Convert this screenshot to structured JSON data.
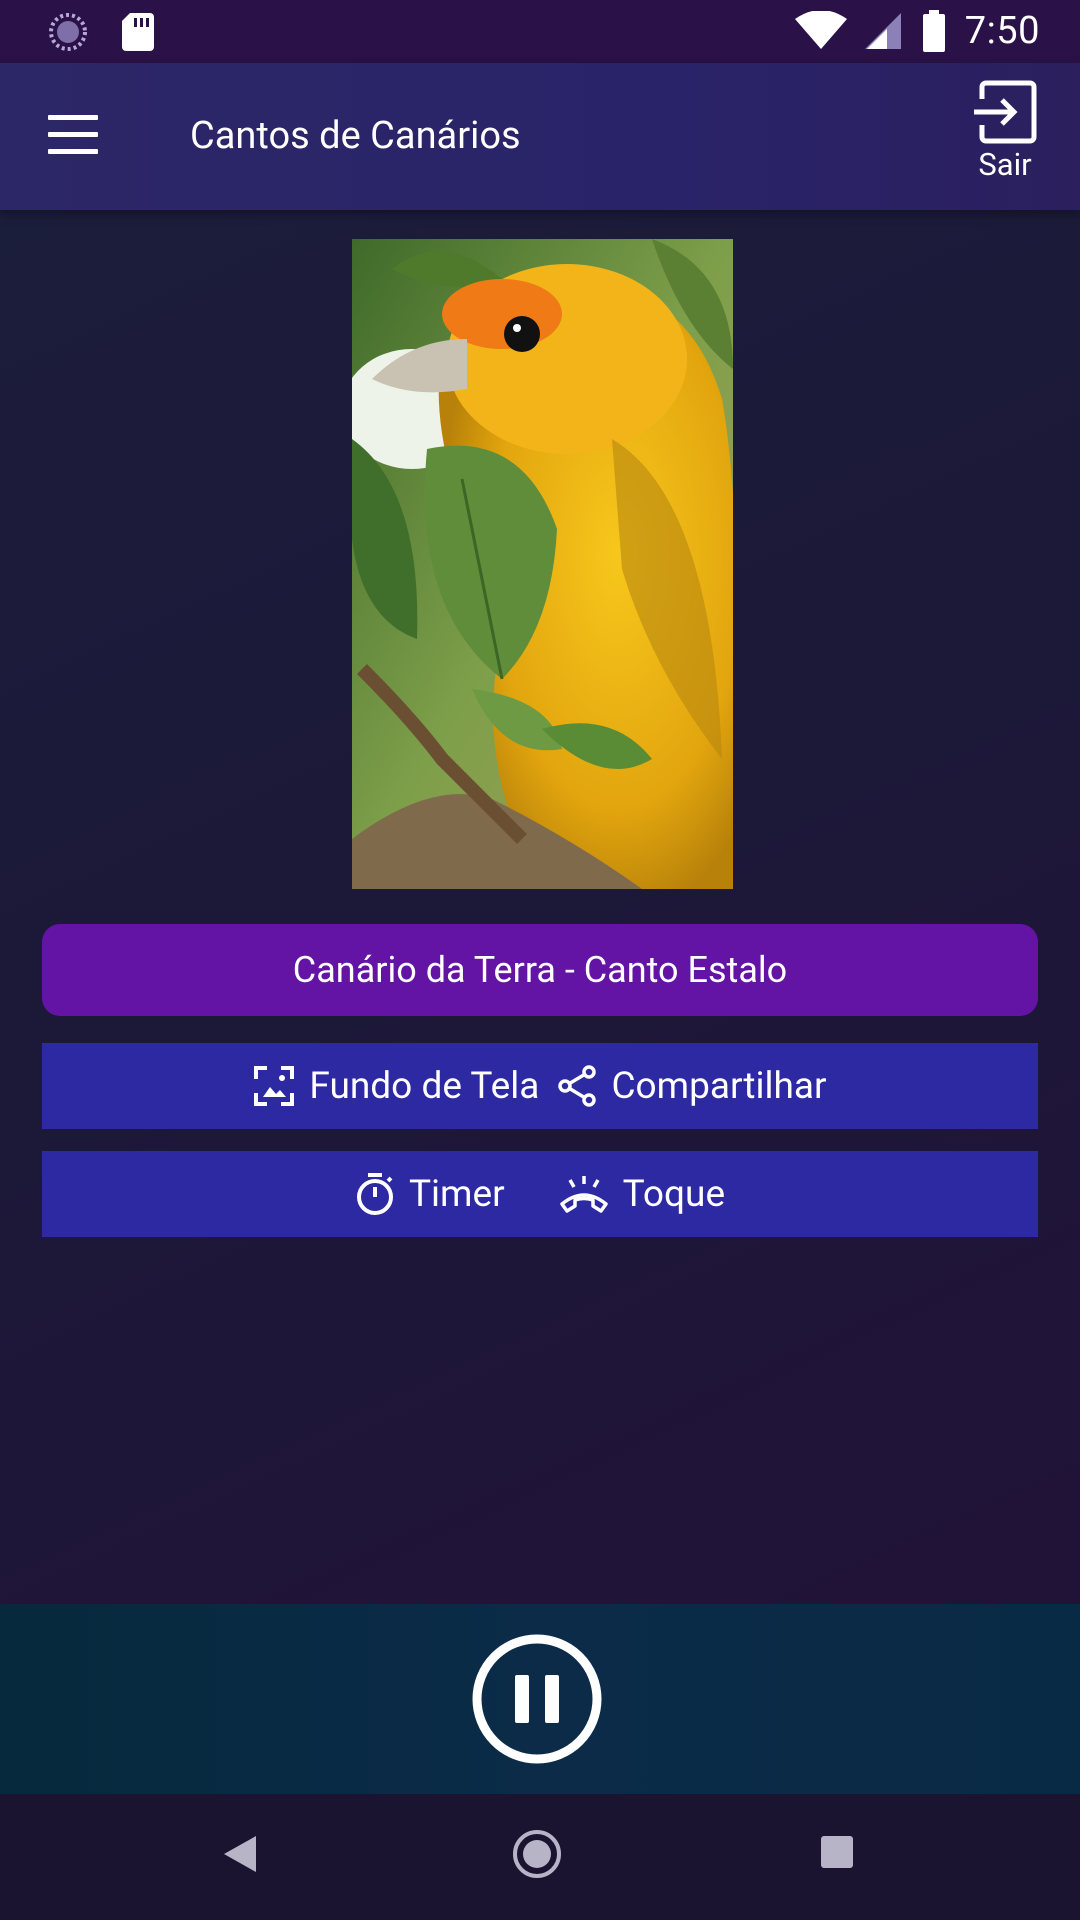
{
  "status_bar": {
    "time": "7:50",
    "icons": [
      "loading-circle-icon",
      "sd-card-icon",
      "wifi-icon",
      "signal-icon",
      "battery-icon"
    ]
  },
  "app_bar": {
    "title": "Cantos de Canários",
    "exit_label": "Sair",
    "icons": [
      "menu-icon",
      "exit-icon"
    ]
  },
  "main": {
    "image_subject": "yellow canary among green leaves",
    "song_title": "Canário da Terra - Canto Estalo",
    "actions": [
      {
        "label": "Fundo de Tela",
        "icon": "wallpaper-icon"
      },
      {
        "label": "Compartilhar",
        "icon": "share-icon"
      },
      {
        "label": "Timer",
        "icon": "timer-icon"
      },
      {
        "label": "Toque",
        "icon": "ringtone-icon"
      }
    ]
  },
  "player": {
    "state_icon": "pause-icon"
  },
  "nav_bar": {
    "icons": [
      "back-icon",
      "home-icon",
      "recent-apps-icon"
    ]
  },
  "colors": {
    "status_bar": "#2a1147",
    "app_bar": "#29246a",
    "song_button": "#6414a4",
    "action_button": "#2c29a3",
    "player_bar": "#0b2b48",
    "nav_bar": "#1a1430"
  }
}
